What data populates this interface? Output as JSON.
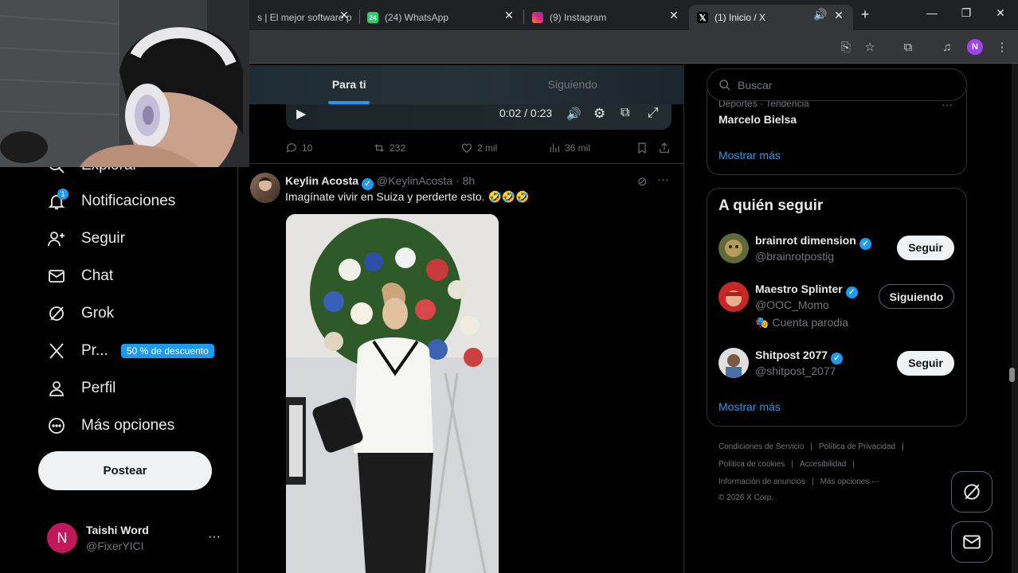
{
  "browser": {
    "tabs": [
      {
        "title": "s | El mejor software p",
        "favicon": "generic",
        "active": false
      },
      {
        "title": "(24) WhatsApp",
        "favicon": "whatsapp-icon",
        "badge": "24",
        "active": false
      },
      {
        "title": "(9) Instagram",
        "favicon": "instagram-icon",
        "active": false
      },
      {
        "title": "(1) Inicio / X",
        "favicon": "x-icon",
        "active": true
      }
    ],
    "profile_initial": "N",
    "colors": {
      "tabstrip": "#202124",
      "toolbar": "#35363a",
      "profile": "#a142f4"
    }
  },
  "nav": {
    "items": [
      {
        "label": "Explorar",
        "icon": "search-icon"
      },
      {
        "label": "Notificaciones",
        "icon": "bell-icon",
        "badge": "1"
      },
      {
        "label": "Seguir",
        "icon": "person-add-icon"
      },
      {
        "label": "Chat",
        "icon": "mail-icon"
      },
      {
        "label": "Grok",
        "icon": "grok-icon"
      },
      {
        "label": "Pr...",
        "icon": "x-logo-icon",
        "promo": "50 % de descuento"
      },
      {
        "label": "Perfil",
        "icon": "person-icon"
      },
      {
        "label": "Más opciones",
        "icon": "more-circle-icon"
      }
    ],
    "post_label": "Postear",
    "user": {
      "initial": "N",
      "name": "Taishi Word",
      "handle": "@FixerYICI",
      "more": "···"
    }
  },
  "feed": {
    "tabs": [
      {
        "label": "Para ti",
        "active": true
      },
      {
        "label": "Siguiendo",
        "active": false
      }
    ],
    "video": {
      "time": "0:02 / 0:23"
    },
    "prev_actions": {
      "replies": "10",
      "reposts": "232",
      "likes": "2 mil",
      "views": "36 mil"
    },
    "tweet": {
      "name": "Keylin Acosta",
      "handle": "@KeylinAcosta · 8h",
      "text": "Imagínate vivir en Suiza y perderte esto. 🤣🤣🤣",
      "more": "···"
    }
  },
  "sidebar": {
    "search_placeholder": "Buscar",
    "trend": {
      "category": "Deportes · Tendencia",
      "name": "Marcelo Bielsa",
      "more": "···"
    },
    "show_more": "Mostrar más",
    "who_to_follow": {
      "title": "A quién seguir",
      "accounts": [
        {
          "name": "brainrot dimension",
          "handle": "@brainrotpostig",
          "button": "Seguir",
          "extra": ""
        },
        {
          "name": "Maestro Splinter",
          "handle": "@OOC_Momo",
          "button": "Siguiendo",
          "extra": "Cuenta parodia"
        },
        {
          "name": "Shitpost 2077",
          "handle": "@shitpost_2077",
          "button": "Seguir",
          "extra": ""
        }
      ],
      "show_more": "Mostrar más"
    },
    "footer": {
      "line1": [
        "Condiciones de Servicio",
        "Política de Privacidad"
      ],
      "line2": [
        "Política de cookies",
        "Accesibilidad"
      ],
      "line3": [
        "Información de anuncios",
        "Más opciones ···"
      ],
      "copyright": "© 2026 X Corp."
    }
  },
  "colors": {
    "accent": "#1d9bf0",
    "text": "#e7e9ea",
    "muted": "#71767b",
    "border": "#2f3336",
    "bg": "#000000"
  }
}
